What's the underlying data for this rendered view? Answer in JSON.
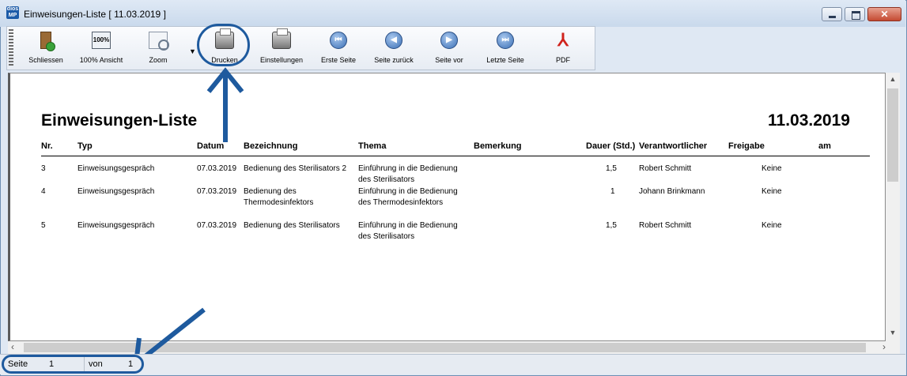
{
  "window": {
    "title": "Einweisungen-Liste [ 11.03.2019 ]",
    "app_icon_text_top": "dios",
    "app_icon_text_bottom": "MP"
  },
  "toolbar": {
    "close_label": "Schliessen",
    "view100_label": "100% Ansicht",
    "view100_icon_text": "100%",
    "zoom_label": "Zoom",
    "print_label": "Drucken",
    "settings_label": "Einstellungen",
    "first_label": "Erste Seite",
    "prev_label": "Seite zurück",
    "next_label": "Seite vor",
    "last_label": "Letzte Seite",
    "pdf_label": "PDF"
  },
  "report": {
    "title": "Einweisungen-Liste",
    "date": "11.03.2019",
    "columns": [
      "Nr.",
      "Typ",
      "Datum",
      "Bezeichnung",
      "Thema",
      "Bemerkung",
      "Dauer (Std.)",
      "Verantwortlicher",
      "Freigabe",
      "am"
    ],
    "rows": [
      {
        "nr": "3",
        "typ": "Einweisungsgespräch",
        "datum": "07.03.2019",
        "bezeichnung": [
          "Bedienung des Sterilisators 2"
        ],
        "thema": [
          "Einführung in die Bedienung",
          "des Sterilisators"
        ],
        "dauer": "1,5",
        "verantwortlicher": "Robert Schmitt",
        "freigabe": "Keine"
      },
      {
        "nr": "4",
        "typ": "Einweisungsgespräch",
        "datum": "07.03.2019",
        "bezeichnung": [
          "Bedienung des",
          "Thermodesinfektors"
        ],
        "thema": [
          "Einführung in die Bedienung",
          "des Thermodesinfektors"
        ],
        "dauer": "1",
        "verantwortlicher": "Johann Brinkmann",
        "freigabe": "Keine"
      },
      {
        "nr": "5",
        "typ": "Einweisungsgespräch",
        "datum": "07.03.2019",
        "bezeichnung": [
          "Bedienung des Sterilisators"
        ],
        "thema": [
          "Einführung in die Bedienung",
          "des Sterilisators"
        ],
        "dauer": "1,5",
        "verantwortlicher": "Robert Schmitt",
        "freigabe": "Keine"
      }
    ]
  },
  "statusbar": {
    "page_label": "Seite",
    "page_value": "1",
    "of_label": "von",
    "of_value": "1"
  },
  "colors": {
    "annotation": "#1e5a9e"
  }
}
